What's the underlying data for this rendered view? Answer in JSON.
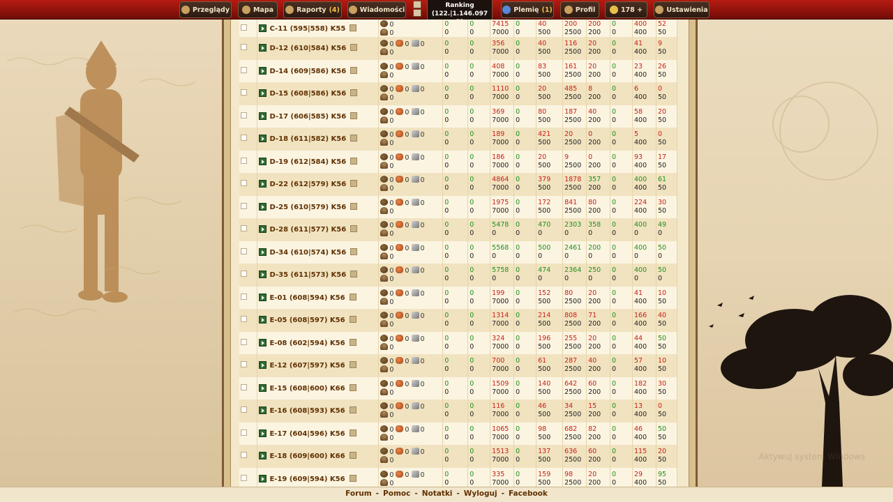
{
  "topbar": {
    "menu": [
      {
        "label": "Przeglądy",
        "count": "",
        "icon": "overview-icon"
      },
      {
        "label": "Mapa",
        "count": "",
        "icon": "map-icon"
      },
      {
        "label": "Raporty",
        "count": "(4)",
        "icon": "reports-icon"
      },
      {
        "label": "Wiadomości",
        "count": "",
        "icon": "messages-icon"
      },
      {
        "label": "Plemię",
        "count": "(1)",
        "icon": "tribe-icon"
      },
      {
        "label": "Profil",
        "count": "",
        "icon": "profile-icon"
      },
      {
        "label": "178 +",
        "count": "",
        "icon": "premium-icon"
      },
      {
        "label": "Ustawienia",
        "count": "",
        "icon": "settings-icon"
      }
    ],
    "ranking_title": "Ranking",
    "ranking_value": "(122.|1.146.097 P)"
  },
  "rows": [
    {
      "name": "C-11 (595|558) K55",
      "res_wood": "0",
      "res_clay": "",
      "res_iron": "",
      "res_pop": "0",
      "c1": "0",
      "c2": "0",
      "a": [
        "7415",
        "7000"
      ],
      "b": "0",
      "c": [
        "40",
        "500"
      ],
      "d": [
        "200",
        "2500"
      ],
      "e": [
        "200",
        "200"
      ],
      "f": "0",
      "g": [
        "400",
        "400"
      ],
      "h": [
        "52",
        "50"
      ],
      "a_red": true,
      "c_red": true,
      "d_red": true,
      "e_red": true,
      "g_red": true,
      "h_red": true
    },
    {
      "name": "D-12 (610|584) K56",
      "res_wood": "0",
      "res_clay": "0",
      "res_iron": "0",
      "res_pop": "0",
      "c1": "0",
      "c2": "0",
      "a": [
        "356",
        "7000"
      ],
      "b": "0",
      "c": [
        "40",
        "500"
      ],
      "d": [
        "116",
        "2500"
      ],
      "e": [
        "20",
        "200"
      ],
      "f": "0",
      "g": [
        "41",
        "400"
      ],
      "h": [
        "9",
        "50"
      ],
      "a_red": true,
      "c_red": true,
      "d_red": true,
      "e_red": true,
      "g_red": true,
      "h_red": true
    },
    {
      "name": "D-14 (609|586) K56",
      "res_wood": "0",
      "res_clay": "0",
      "res_iron": "0",
      "res_pop": "0",
      "c1": "0",
      "c2": "0",
      "a": [
        "408",
        "7000"
      ],
      "b": "0",
      "c": [
        "83",
        "500"
      ],
      "d": [
        "161",
        "2500"
      ],
      "e": [
        "20",
        "200"
      ],
      "f": "0",
      "g": [
        "23",
        "400"
      ],
      "h": [
        "26",
        "50"
      ],
      "a_red": true,
      "c_red": true,
      "d_red": true,
      "e_red": true,
      "g_red": true,
      "h_red": true
    },
    {
      "name": "D-15 (608|586) K56",
      "res_wood": "0",
      "res_clay": "0",
      "res_iron": "0",
      "res_pop": "0",
      "c1": "0",
      "c2": "0",
      "a": [
        "1110",
        "7000"
      ],
      "b": "0",
      "c": [
        "20",
        "500"
      ],
      "d": [
        "485",
        "2500"
      ],
      "e": [
        "8",
        "200"
      ],
      "f": "0",
      "g": [
        "6",
        "400"
      ],
      "h": [
        "0",
        "50"
      ],
      "a_red": true,
      "c_red": true,
      "d_red": true,
      "e_red": true,
      "g_red": true,
      "h_red": true
    },
    {
      "name": "D-17 (606|585) K56",
      "res_wood": "0",
      "res_clay": "0",
      "res_iron": "0",
      "res_pop": "0",
      "c1": "0",
      "c2": "0",
      "a": [
        "369",
        "7000"
      ],
      "b": "0",
      "c": [
        "80",
        "500"
      ],
      "d": [
        "187",
        "2500"
      ],
      "e": [
        "40",
        "200"
      ],
      "f": "0",
      "g": [
        "58",
        "400"
      ],
      "h": [
        "20",
        "50"
      ],
      "a_red": true,
      "c_red": true,
      "d_red": true,
      "e_red": true,
      "g_red": true,
      "h_red": true
    },
    {
      "name": "D-18 (611|582) K56",
      "res_wood": "0",
      "res_clay": "0",
      "res_iron": "0",
      "res_pop": "0",
      "c1": "0",
      "c2": "0",
      "a": [
        "189",
        "7000"
      ],
      "b": "0",
      "c": [
        "421",
        "500"
      ],
      "d": [
        "20",
        "2500"
      ],
      "e": [
        "0",
        "200"
      ],
      "f": "0",
      "g": [
        "5",
        "400"
      ],
      "h": [
        "0",
        "50"
      ],
      "a_red": true,
      "c_red": true,
      "d_red": true,
      "e_red": true,
      "g_red": true,
      "h_red": true
    },
    {
      "name": "D-19 (612|584) K56",
      "res_wood": "0",
      "res_clay": "0",
      "res_iron": "0",
      "res_pop": "0",
      "c1": "0",
      "c2": "0",
      "a": [
        "186",
        "7000"
      ],
      "b": "0",
      "c": [
        "20",
        "500"
      ],
      "d": [
        "9",
        "2500"
      ],
      "e": [
        "0",
        "200"
      ],
      "f": "0",
      "g": [
        "93",
        "400"
      ],
      "h": [
        "17",
        "50"
      ],
      "a_red": true,
      "c_red": true,
      "d_red": true,
      "e_red": true,
      "g_red": true,
      "h_red": true
    },
    {
      "name": "D-22 (612|579) K56",
      "res_wood": "0",
      "res_clay": "0",
      "res_iron": "0",
      "res_pop": "0",
      "c1": "0",
      "c2": "0",
      "a": [
        "4864",
        "7000"
      ],
      "b": "0",
      "c": [
        "379",
        "500"
      ],
      "d": [
        "1878",
        "2500"
      ],
      "e": [
        "357",
        "200"
      ],
      "f": "0",
      "g": [
        "400",
        "400"
      ],
      "h": [
        "61",
        "50"
      ],
      "a_red": true,
      "c_red": true,
      "d_red": true,
      "e_red": false,
      "g_red": false,
      "h_red": false
    },
    {
      "name": "D-25 (610|579) K56",
      "res_wood": "0",
      "res_clay": "0",
      "res_iron": "0",
      "res_pop": "0",
      "c1": "0",
      "c2": "0",
      "a": [
        "1975",
        "7000"
      ],
      "b": "0",
      "c": [
        "172",
        "500"
      ],
      "d": [
        "841",
        "2500"
      ],
      "e": [
        "80",
        "200"
      ],
      "f": "0",
      "g": [
        "224",
        "400"
      ],
      "h": [
        "30",
        "50"
      ],
      "a_red": true,
      "c_red": true,
      "d_red": true,
      "e_red": true,
      "g_red": true,
      "h_red": true
    },
    {
      "name": "D-28 (611|577) K56",
      "res_wood": "0",
      "res_clay": "0",
      "res_iron": "0",
      "res_pop": "0",
      "c1": "0",
      "c2": "0",
      "a": [
        "5478",
        "0"
      ],
      "b": "0",
      "c": [
        "470",
        "0"
      ],
      "d": [
        "2303",
        "0"
      ],
      "e": [
        "358",
        "0"
      ],
      "f": "0",
      "g": [
        "400",
        "0"
      ],
      "h": [
        "49",
        "0"
      ],
      "a_red": false,
      "c_red": false,
      "d_red": false,
      "e_red": false,
      "g_red": false,
      "h_red": false
    },
    {
      "name": "D-34 (610|574) K56",
      "res_wood": "0",
      "res_clay": "0",
      "res_iron": "0",
      "res_pop": "0",
      "c1": "0",
      "c2": "0",
      "a": [
        "5568",
        "0"
      ],
      "b": "0",
      "c": [
        "500",
        "0"
      ],
      "d": [
        "2461",
        "0"
      ],
      "e": [
        "200",
        "0"
      ],
      "f": "0",
      "g": [
        "400",
        "0"
      ],
      "h": [
        "50",
        "0"
      ],
      "a_red": false,
      "c_red": false,
      "d_red": false,
      "e_red": false,
      "g_red": false,
      "h_red": false
    },
    {
      "name": "D-35 (611|573) K56",
      "res_wood": "0",
      "res_clay": "0",
      "res_iron": "0",
      "res_pop": "0",
      "c1": "0",
      "c2": "0",
      "a": [
        "5758",
        "0"
      ],
      "b": "0",
      "c": [
        "474",
        "0"
      ],
      "d": [
        "2364",
        "0"
      ],
      "e": [
        "250",
        "0"
      ],
      "f": "0",
      "g": [
        "400",
        "0"
      ],
      "h": [
        "50",
        "0"
      ],
      "a_red": false,
      "c_red": false,
      "d_red": false,
      "e_red": false,
      "g_red": false,
      "h_red": false
    },
    {
      "name": "E-01 (608|594) K56",
      "res_wood": "0",
      "res_clay": "0",
      "res_iron": "0",
      "res_pop": "0",
      "c1": "0",
      "c2": "0",
      "a": [
        "199",
        "7000"
      ],
      "b": "0",
      "c": [
        "152",
        "500"
      ],
      "d": [
        "80",
        "2500"
      ],
      "e": [
        "20",
        "200"
      ],
      "f": "0",
      "g": [
        "41",
        "400"
      ],
      "h": [
        "10",
        "50"
      ],
      "a_red": true,
      "c_red": true,
      "d_red": true,
      "e_red": true,
      "g_red": true,
      "h_red": true
    },
    {
      "name": "E-05 (608|597) K56",
      "res_wood": "0",
      "res_clay": "0",
      "res_iron": "0",
      "res_pop": "0",
      "c1": "0",
      "c2": "0",
      "a": [
        "1314",
        "7000"
      ],
      "b": "0",
      "c": [
        "214",
        "500"
      ],
      "d": [
        "808",
        "2500"
      ],
      "e": [
        "71",
        "200"
      ],
      "f": "0",
      "g": [
        "166",
        "400"
      ],
      "h": [
        "40",
        "50"
      ],
      "a_red": true,
      "c_red": true,
      "d_red": true,
      "e_red": true,
      "g_red": true,
      "h_red": true
    },
    {
      "name": "E-08 (602|594) K56",
      "res_wood": "0",
      "res_clay": "0",
      "res_iron": "0",
      "res_pop": "0",
      "c1": "0",
      "c2": "0",
      "a": [
        "324",
        "7000"
      ],
      "b": "0",
      "c": [
        "196",
        "500"
      ],
      "d": [
        "255",
        "2500"
      ],
      "e": [
        "20",
        "200"
      ],
      "f": "0",
      "g": [
        "44",
        "400"
      ],
      "h": [
        "50",
        "50"
      ],
      "a_red": true,
      "c_red": true,
      "d_red": true,
      "e_red": true,
      "g_red": true,
      "h_red": false
    },
    {
      "name": "E-12 (607|597) K56",
      "res_wood": "0",
      "res_clay": "0",
      "res_iron": "0",
      "res_pop": "0",
      "c1": "0",
      "c2": "0",
      "a": [
        "700",
        "7000"
      ],
      "b": "0",
      "c": [
        "61",
        "500"
      ],
      "d": [
        "287",
        "2500"
      ],
      "e": [
        "40",
        "200"
      ],
      "f": "0",
      "g": [
        "57",
        "400"
      ],
      "h": [
        "10",
        "50"
      ],
      "a_red": true,
      "c_red": true,
      "d_red": true,
      "e_red": true,
      "g_red": true,
      "h_red": true
    },
    {
      "name": "E-15 (608|600) K66",
      "res_wood": "0",
      "res_clay": "0",
      "res_iron": "0",
      "res_pop": "0",
      "c1": "0",
      "c2": "0",
      "a": [
        "1509",
        "7000"
      ],
      "b": "0",
      "c": [
        "140",
        "500"
      ],
      "d": [
        "642",
        "2500"
      ],
      "e": [
        "60",
        "200"
      ],
      "f": "0",
      "g": [
        "182",
        "400"
      ],
      "h": [
        "30",
        "50"
      ],
      "a_red": true,
      "c_red": true,
      "d_red": true,
      "e_red": true,
      "g_red": true,
      "h_red": true
    },
    {
      "name": "E-16 (608|593) K56",
      "res_wood": "0",
      "res_clay": "0",
      "res_iron": "0",
      "res_pop": "0",
      "c1": "0",
      "c2": "0",
      "a": [
        "116",
        "7000"
      ],
      "b": "0",
      "c": [
        "46",
        "500"
      ],
      "d": [
        "34",
        "2500"
      ],
      "e": [
        "15",
        "200"
      ],
      "f": "0",
      "g": [
        "13",
        "400"
      ],
      "h": [
        "0",
        "50"
      ],
      "a_red": true,
      "c_red": true,
      "d_red": true,
      "e_red": true,
      "g_red": true,
      "h_red": true
    },
    {
      "name": "E-17 (604|596) K56",
      "res_wood": "0",
      "res_clay": "0",
      "res_iron": "0",
      "res_pop": "0",
      "c1": "0",
      "c2": "0",
      "a": [
        "1065",
        "7000"
      ],
      "b": "0",
      "c": [
        "98",
        "500"
      ],
      "d": [
        "682",
        "2500"
      ],
      "e": [
        "82",
        "200"
      ],
      "f": "0",
      "g": [
        "46",
        "400"
      ],
      "h": [
        "50",
        "50"
      ],
      "a_red": true,
      "c_red": true,
      "d_red": true,
      "e_red": true,
      "g_red": true,
      "h_red": false
    },
    {
      "name": "E-18 (609|600) K66",
      "res_wood": "0",
      "res_clay": "0",
      "res_iron": "0",
      "res_pop": "0",
      "c1": "0",
      "c2": "0",
      "a": [
        "1513",
        "7000"
      ],
      "b": "0",
      "c": [
        "137",
        "500"
      ],
      "d": [
        "636",
        "2500"
      ],
      "e": [
        "60",
        "200"
      ],
      "f": "0",
      "g": [
        "115",
        "400"
      ],
      "h": [
        "20",
        "50"
      ],
      "a_red": true,
      "c_red": true,
      "d_red": true,
      "e_red": true,
      "g_red": true,
      "h_red": true
    },
    {
      "name": "E-19 (609|594) K56",
      "res_wood": "0",
      "res_clay": "0",
      "res_iron": "0",
      "res_pop": "0",
      "c1": "0",
      "c2": "0",
      "a": [
        "335",
        "7000"
      ],
      "b": "0",
      "c": [
        "159",
        "500"
      ],
      "d": [
        "98",
        "2500"
      ],
      "e": [
        "20",
        "200"
      ],
      "f": "0",
      "g": [
        "29",
        "400"
      ],
      "h": [
        "95",
        "50"
      ],
      "a_red": true,
      "c_red": true,
      "d_red": true,
      "e_red": true,
      "g_red": true,
      "h_red": false
    }
  ],
  "footer": {
    "links": [
      "Forum",
      "Pomoc",
      "Notatki",
      "Wyloguj",
      "Facebook"
    ]
  },
  "watermark": "Aktywuj system Windows",
  "colors": {
    "topbar": "#9e1710",
    "green": "#1f8f1f",
    "red": "#c8201a",
    "village_name": "#603000"
  }
}
